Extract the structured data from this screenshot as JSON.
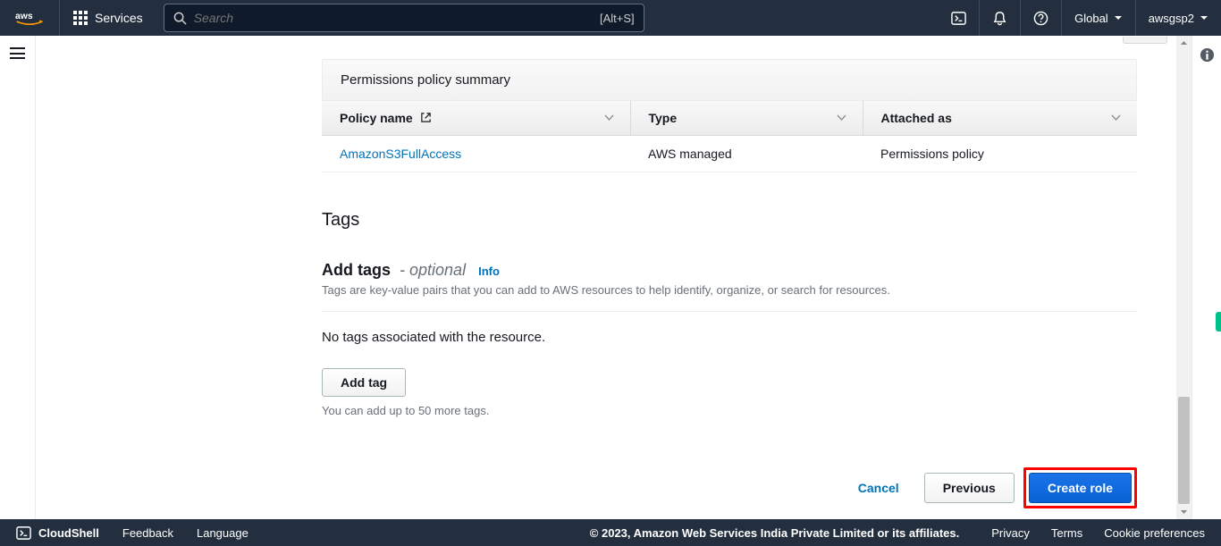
{
  "nav": {
    "services_label": "Services",
    "search_placeholder": "Search",
    "search_shortcut": "[Alt+S]",
    "region": "Global",
    "account": "awsgsp2"
  },
  "permissions": {
    "panel_title": "Permissions policy summary",
    "col_policy": "Policy name",
    "col_type": "Type",
    "col_attached": "Attached as",
    "rows": [
      {
        "name": "AmazonS3FullAccess",
        "type": "AWS managed",
        "attached": "Permissions policy"
      }
    ]
  },
  "tags": {
    "section_title": "Tags",
    "add_label": "Add tags",
    "optional": " - optional",
    "info": "Info",
    "description": "Tags are key-value pairs that you can add to AWS resources to help identify, organize, or search for resources.",
    "empty": "No tags associated with the resource.",
    "add_button": "Add tag",
    "limit": "You can add up to 50 more tags."
  },
  "wizard": {
    "cancel": "Cancel",
    "previous": "Previous",
    "create": "Create role"
  },
  "footer": {
    "cloudshell": "CloudShell",
    "feedback": "Feedback",
    "language": "Language",
    "copyright": "© 2023, Amazon Web Services India Private Limited or its affiliates.",
    "privacy": "Privacy",
    "terms": "Terms",
    "cookies": "Cookie preferences"
  }
}
